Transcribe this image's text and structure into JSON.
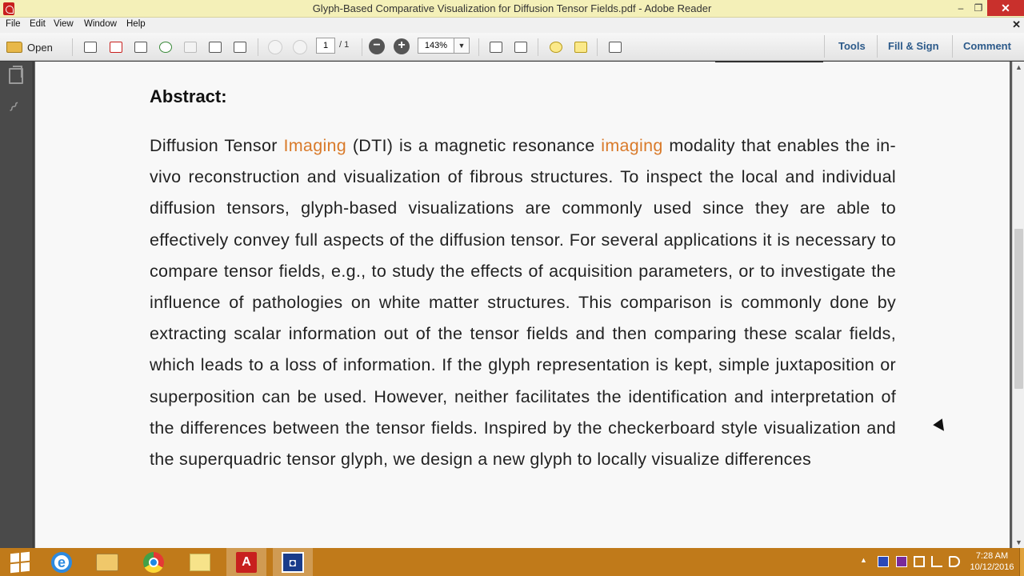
{
  "window": {
    "title": "Glyph-Based Comparative Visualization for Diffusion Tensor Fields.pdf - Adobe Reader",
    "minimize": "–",
    "maximize": "❐",
    "close": "✕"
  },
  "menu": {
    "items": [
      "File",
      "Edit",
      "View",
      "Window",
      "Help"
    ],
    "doc_close": "✕"
  },
  "toolbar": {
    "open_label": "Open",
    "page_current": "1",
    "page_total": "/ 1",
    "zoom_value": "143%",
    "zoom_out": "−",
    "zoom_in": "+",
    "dropdown_arrow": "▼",
    "tools_label": "Tools",
    "fill_sign_label": "Fill & Sign",
    "comment_label": "Comment"
  },
  "document": {
    "heading": "Abstract:",
    "body": [
      {
        "text": "Diffusion Tensor ",
        "highlight": false
      },
      {
        "text": "Imaging",
        "highlight": true
      },
      {
        "text": " (DTI) is a magnetic resonance ",
        "highlight": false
      },
      {
        "text": "imaging",
        "highlight": true
      },
      {
        "text": " modality that enables the in-vivo reconstruction and visualization of fibrous structures. To inspect the local and individual diffusion tensors, glyph-based visualizations are commonly used since they are able to effectively convey full aspects of the diffusion tensor. For several applications it is necessary to compare tensor fields, e.g., to study the effects of acquisition parameters, or to investigate the influence of pathologies on white matter structures. This comparison is commonly done by extracting scalar information out of the tensor fields and then comparing these scalar fields, which leads to a loss of information. If the glyph representation is kept, simple juxtaposition or superposition can be used. However, neither facilitates the identification and interpretation of the differences between the tensor fields. Inspired by the checkerboard style visualization and the superquadric tensor glyph, we design a new glyph to locally visualize differences",
        "highlight": false
      }
    ]
  },
  "taskbar": {
    "clock_time": "7:28 AM",
    "clock_date": "10/12/2016",
    "tray_up_arrow": "▲"
  },
  "colors": {
    "highlight": "#d97a2a",
    "taskbar": "#c07a1a",
    "title_bar": "#f4f0b8",
    "link": "#2c5a8a"
  }
}
